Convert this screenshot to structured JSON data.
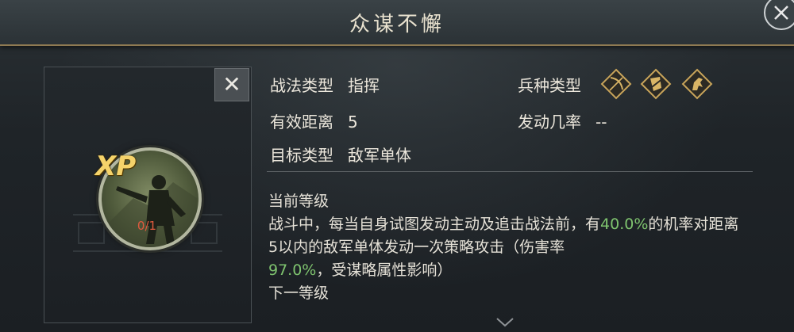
{
  "header": {
    "title": "众谋不懈"
  },
  "left_panel": {
    "badge": "XP",
    "count": "0/1"
  },
  "info": {
    "tactic_type_label": "战法类型",
    "tactic_type_value": "指挥",
    "range_label": "有效距离",
    "range_value": "5",
    "target_label": "目标类型",
    "target_value": "敌军单体",
    "troop_type_label": "兵种类型",
    "trigger_rate_label": "发动几率",
    "trigger_rate_value": "--",
    "troop_icons": [
      "bow-icon",
      "shield-icon",
      "horse-icon"
    ]
  },
  "description": {
    "current_level_label": "当前等级",
    "text_part1": "战斗中，每当自身试图发动主动及追击战法前，有",
    "rate": "40.0%",
    "text_part2": "的机率对距离5以内的敌军单体发动一次策略攻击（伤害率",
    "damage_rate": "97.0%",
    "text_part3": "，受谋略属性影响）",
    "next_level_label": "下一等级"
  },
  "colors": {
    "highlight": "#7fc46f",
    "gold": "#c8a45a",
    "xp_count": "#e05a3e"
  }
}
